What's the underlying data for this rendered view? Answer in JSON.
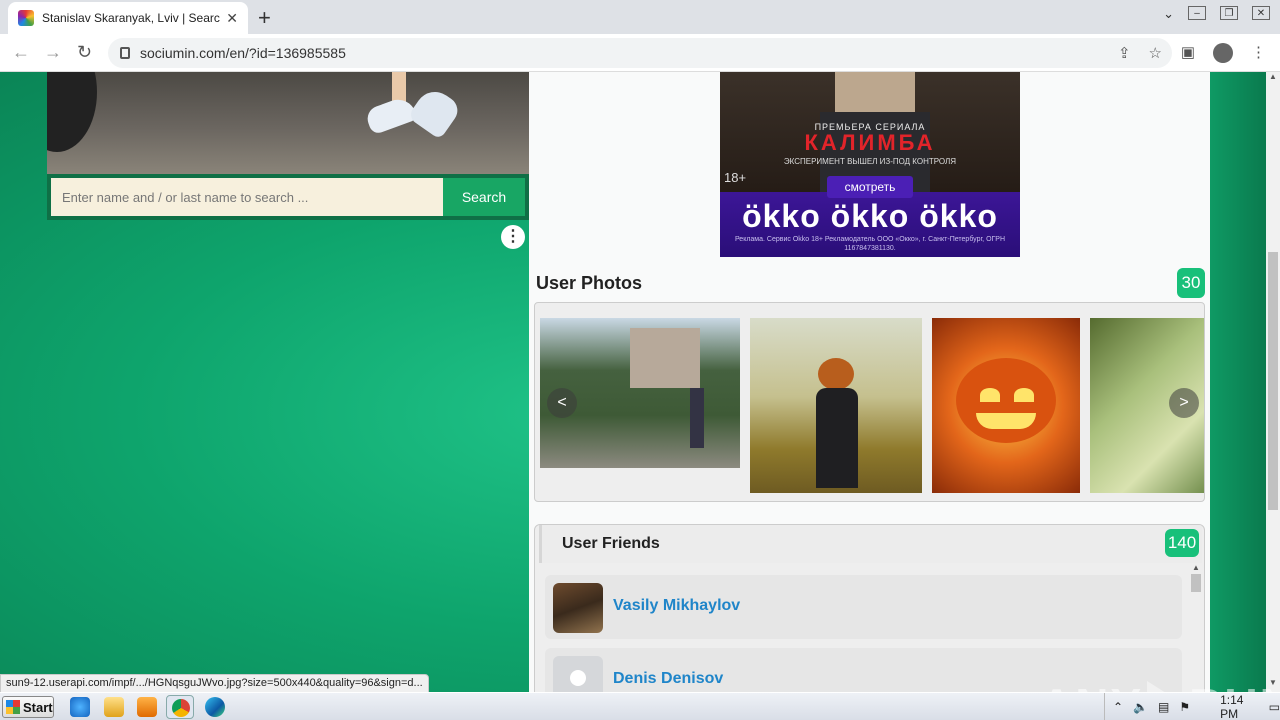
{
  "browser": {
    "tab_title": "Stanislav Skaranyak, Lviv | Search In",
    "url": "sociumin.com/en/?id=136985585"
  },
  "search": {
    "placeholder": "Enter name and / or last name to search ...",
    "button_label": "Search"
  },
  "ad": {
    "premiere": "ПРЕМЬЕРА СЕРИАЛА",
    "brand": "КАЛИМБА",
    "tagline": "ЭКСПЕРИМЕНТ ВЫШЕЛ ИЗ-ПОД КОНТРОЛЯ",
    "age": "18+",
    "watch_label": "смотреть",
    "logos": "ökko ökko ökko",
    "legal": "Реклама. Сервис Okko 18+ Рекламодатель ООО «Оккo», г. Санкт-Петербург, ОГРН 1167847381130."
  },
  "photos": {
    "title": "User Photos",
    "count": "30",
    "prev_label": "<",
    "next_label": ">"
  },
  "friends": {
    "title": "User Friends",
    "count": "140",
    "items": [
      {
        "name": "Vasily Mikhaylov"
      },
      {
        "name": "Denis Denisov"
      }
    ]
  },
  "status_bar": {
    "text": "sun9-12.userapi.com/impf/.../HGNqsguJWvo.jpg?size=500x440&quality=96&sign=d..."
  },
  "watermark": {
    "left": "ANY",
    "right": "RUN"
  },
  "taskbar": {
    "start_label": "Start",
    "time": "1:14 PM"
  },
  "colors": {
    "accent_green": "#18c07a",
    "link_blue": "#1f85c9",
    "background_green": "#0ea46c"
  }
}
